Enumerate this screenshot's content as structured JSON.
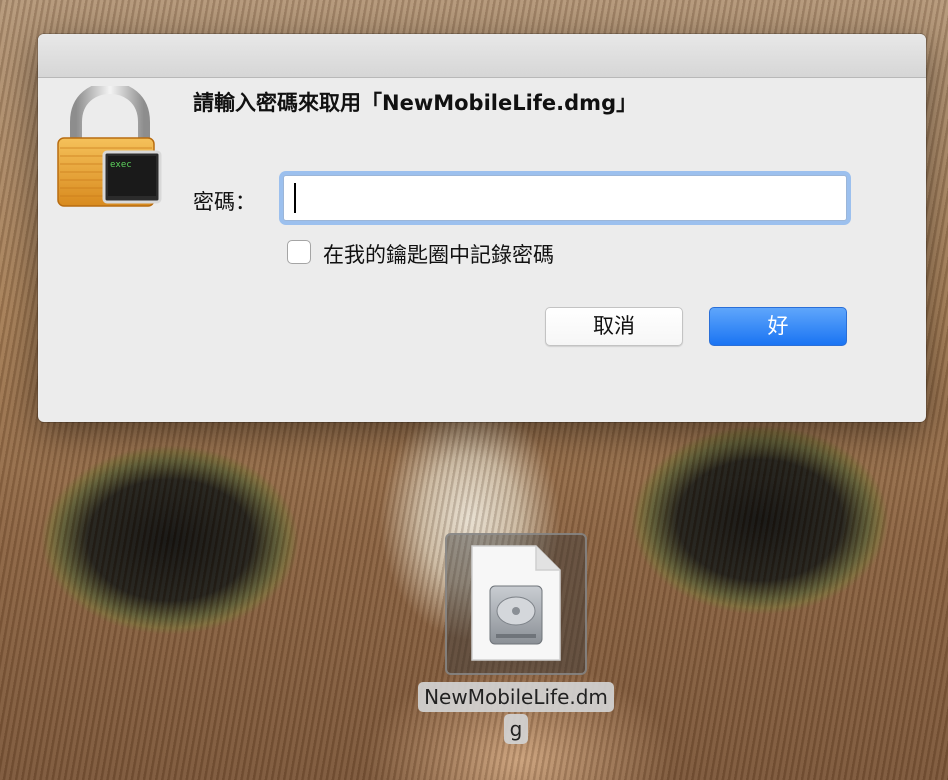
{
  "dialog": {
    "prompt": "請輸入密碼來取用「NewMobileLife.dmg」",
    "password_label": "密碼：",
    "password_value": "",
    "remember_label": "在我的鑰匙圈中記錄密碼",
    "remember_checked": false,
    "cancel_label": "取消",
    "ok_label": "好",
    "icon": "lock-exec-icon",
    "icon_text": "exec"
  },
  "desktop": {
    "file_name_line1": "NewMobileLife.dm",
    "file_name_line2": "g",
    "file_icon": "disk-image-icon"
  },
  "colors": {
    "accent": "#1a74f3",
    "focus_ring": "#9cc0ee"
  }
}
